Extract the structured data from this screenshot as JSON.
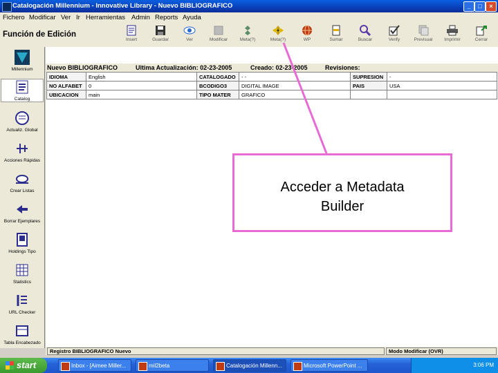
{
  "window": {
    "title": "Catalogación Millennium - Innovative Library - Nuevo BIBLIOGRAFICO",
    "min": "_",
    "max": "□",
    "close": "×"
  },
  "menu": [
    "Fichero",
    "Modificar",
    "Ver",
    "Ir",
    "Herramientas",
    "Admin",
    "Reports",
    "Ayuda"
  ],
  "function_title": "Función de Edición",
  "toolbar": [
    {
      "label": "Insert",
      "icon": "insert-icon",
      "color": "#2c2c8c"
    },
    {
      "label": "Guardar",
      "icon": "save-icon",
      "color": "#333333"
    },
    {
      "label": "Ver",
      "icon": "view-icon",
      "color": "#2a6ad0"
    },
    {
      "label": "Modificar",
      "icon": "modify-icon",
      "color": "#999999"
    },
    {
      "label": "Meta(?)",
      "icon": "metadata-icon",
      "color": "#5c8c6a"
    },
    {
      "label": "Meta(?)",
      "icon": "metadata-builder-icon",
      "color": "#c8a000"
    },
    {
      "label": "WP",
      "icon": "web-icon",
      "color": "#c03a14"
    },
    {
      "label": "Sumar",
      "icon": "summary-icon",
      "color": "#e0b000"
    },
    {
      "label": "Buscar",
      "icon": "search-icon",
      "color": "#5a3aa8"
    },
    {
      "label": "Verify",
      "icon": "verify-icon",
      "color": "#333333"
    },
    {
      "label": "Previsual",
      "icon": "preview-icon",
      "color": "#999999"
    },
    {
      "label": "Imprimir",
      "icon": "print-icon",
      "color": "#333333"
    },
    {
      "label": "Cerrar",
      "icon": "close-record-icon",
      "color": "#1a8a2a"
    }
  ],
  "sidebar": [
    {
      "label": "Millennium",
      "icon": "millennium-logo-icon"
    },
    {
      "label": "Catalog",
      "icon": "catalog-icon"
    },
    {
      "label": "Actualiz. Global",
      "icon": "global-update-icon"
    },
    {
      "label": "Acciones Rápidas",
      "icon": "rapid-actions-icon"
    },
    {
      "label": "Crear Listas",
      "icon": "create-lists-icon"
    },
    {
      "label": "Borrar Ejemplares",
      "icon": "delete-items-icon"
    },
    {
      "label": "Holdings Tipo",
      "icon": "holdings-icon"
    },
    {
      "label": "Statistics",
      "icon": "statistics-icon"
    },
    {
      "label": "URL Checker",
      "icon": "url-checker-icon"
    },
    {
      "label": "Tabla Encabezado",
      "icon": "headings-table-icon"
    }
  ],
  "record_header": {
    "type": "Nuevo BIBLIOGRAFICO",
    "last_update": "Ultima Actualización: 02-23-2005",
    "created": "Creado: 02-23-2005",
    "revisions": "Revisiones:"
  },
  "fields": [
    [
      {
        "k": "IDIOMA",
        "v": "English"
      },
      {
        "k": "CATALOGADO",
        "v": "- -"
      },
      {
        "k": "SUPRESION",
        "v": "-"
      }
    ],
    [
      {
        "k": "NO ALFABET",
        "v": "0"
      },
      {
        "k": "BCODIGO3",
        "v": "DIGITAL IMAGE"
      },
      {
        "k": "PAIS",
        "v": "USA"
      }
    ],
    [
      {
        "k": "UBICACION",
        "v": "main"
      },
      {
        "k": "TIPO MATER",
        "v": "GRAFICO"
      },
      {
        "k": "",
        "v": ""
      }
    ]
  ],
  "status": {
    "left": "Registro BIBLIOGRAFICO Nuevo",
    "right": "Modo Modificar (OVR)"
  },
  "taskbar": {
    "start": "start",
    "tasks": [
      "Inbox - [Aimee Miller...",
      "mil2beta",
      "Catalogación Millenn...",
      "Microsoft PowerPoint ..."
    ],
    "clock": "3:06 PM"
  },
  "callout": {
    "line1": "Acceder a Metadata",
    "line2": "Builder",
    "color": "#e86ad4"
  }
}
